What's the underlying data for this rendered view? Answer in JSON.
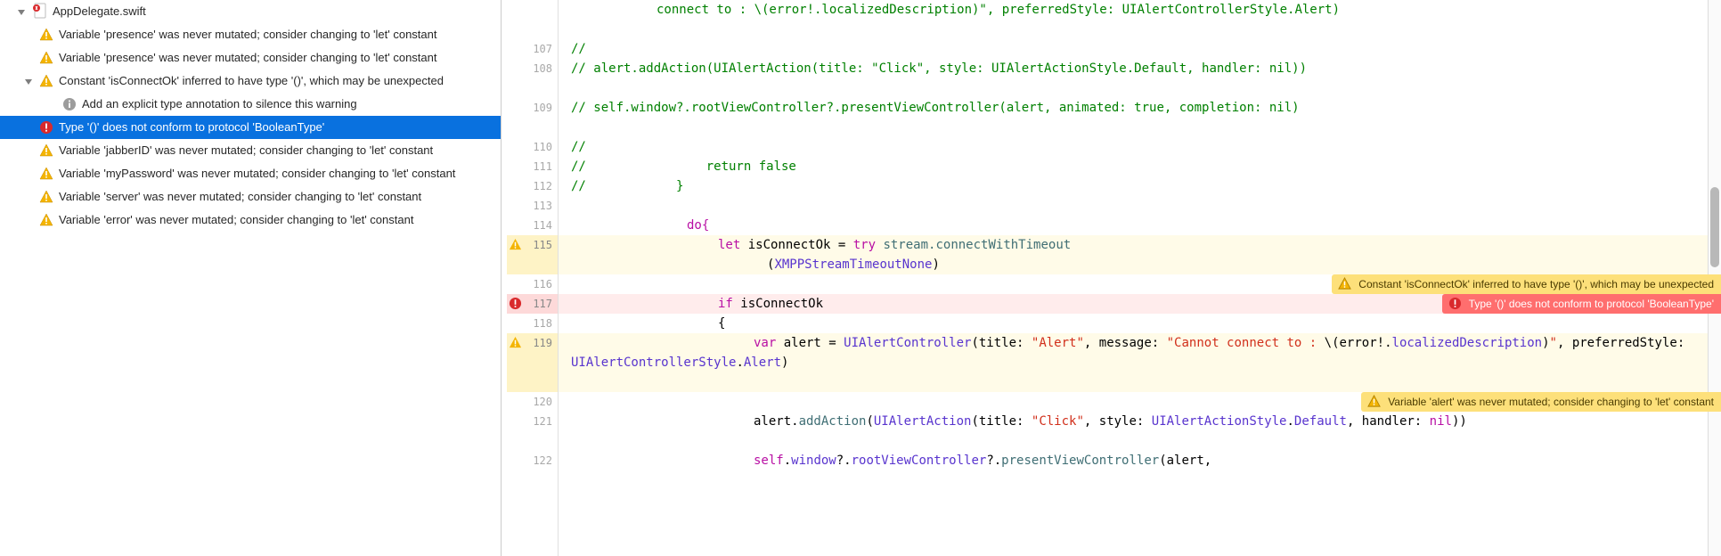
{
  "sidebar": {
    "file_name": "AppDelegate.swift",
    "items": [
      {
        "type": "warning",
        "text": "Variable 'presence' was never mutated; consider changing to 'let' constant"
      },
      {
        "type": "warning",
        "text": "Variable 'presence' was never mutated; consider changing to 'let' constant"
      },
      {
        "type": "warning",
        "expandable": true,
        "text": "Constant 'isConnectOk' inferred to have type '()', which may be unexpected"
      },
      {
        "type": "info",
        "indent": 1,
        "text": "Add an explicit type annotation to silence this warning"
      },
      {
        "type": "error",
        "selected": true,
        "text": "Type '()' does not conform to protocol 'BooleanType'"
      },
      {
        "type": "warning",
        "text": "Variable 'jabberID' was never mutated; consider changing to 'let' constant"
      },
      {
        "type": "warning",
        "text": "Variable 'myPassword' was never mutated; consider changing to 'let' constant"
      },
      {
        "type": "warning",
        "text": "Variable 'server' was never mutated; consider changing to 'let' constant"
      },
      {
        "type": "warning",
        "text": "Variable 'error' was never mutated; consider changing to 'let' constant"
      }
    ]
  },
  "editor": {
    "line_numbers": [
      null,
      "107",
      "108",
      null,
      "109",
      null,
      "110",
      "111",
      "112",
      "113",
      "114",
      "115",
      null,
      "116",
      "117",
      "118",
      "119",
      null,
      null,
      "120",
      "121",
      null,
      "122"
    ],
    "gutter_flags": {
      "115": "warn",
      "117": "err",
      "119": "warn"
    },
    "code": {
      "l0": "connect to : \\(error!.localizedDescription)\", preferredStyle: UIAlertControllerStyle.Alert)",
      "l107": "//",
      "l108": "//                alert.addAction(UIAlertAction(title: \"Click\", style: UIAlertActionStyle.Default, handler: nil))",
      "l109": "//                self.window?.rootViewController?.presentViewController(alert, animated: true, completion: nil)",
      "l110": "//",
      "l111": "//                return false",
      "l112": "//            }",
      "l113": "",
      "l114": "do{",
      "l115a": "let ",
      "l115b": "isConnectOk = ",
      "l115c": "try ",
      "l115d": "stream.",
      "l115e": "connectWithTimeout",
      "l115f": "(",
      "l115g": "XMPPStreamTimeoutNone",
      "l115h": ")",
      "l116": "",
      "l117a": "if ",
      "l117b": "isConnectOk",
      "l118": "{",
      "l119a": "var ",
      "l119b": "alert = ",
      "l119c": "UIAlertController",
      "l119d": "(title: ",
      "l119e": "\"Alert\"",
      "l119f": ", message: ",
      "l119g": "\"Cannot connect to : ",
      "l119h": "\\(",
      "l119i": "error!.",
      "l119j": "localizedDescription",
      "l119k": ")",
      "l119l": "\"",
      "l119m": ", preferredStyle: ",
      "l119n": "UIAlertControllerStyle",
      "l119o": ".",
      "l119p": "Alert",
      "l119q": ")",
      "l120": "",
      "l121a": "alert.",
      "l121b": "addAction",
      "l121c": "(",
      "l121d": "UIAlertAction",
      "l121e": "(title: ",
      "l121f": "\"Click\"",
      "l121g": ", style: ",
      "l121h": "UIAlertActionStyle",
      "l121i": ".",
      "l121j": "Default",
      "l121k": ", handler: ",
      "l121l": "nil",
      "l121m": "))",
      "l122a": "self",
      "l122b": ".",
      "l122c": "window",
      "l122d": "?.",
      "l122e": "rootViewController",
      "l122f": "?.",
      "l122g": "presentViewController",
      "l122h": "(alert,"
    },
    "inline_issues": {
      "i116": "Constant 'isConnectOk' inferred to have type '()', which may be unexpected",
      "i117": "Type '()' does not conform to protocol 'BooleanType'",
      "i120": "Variable 'alert' was never mutated; consider changing to 'let' constant"
    }
  }
}
